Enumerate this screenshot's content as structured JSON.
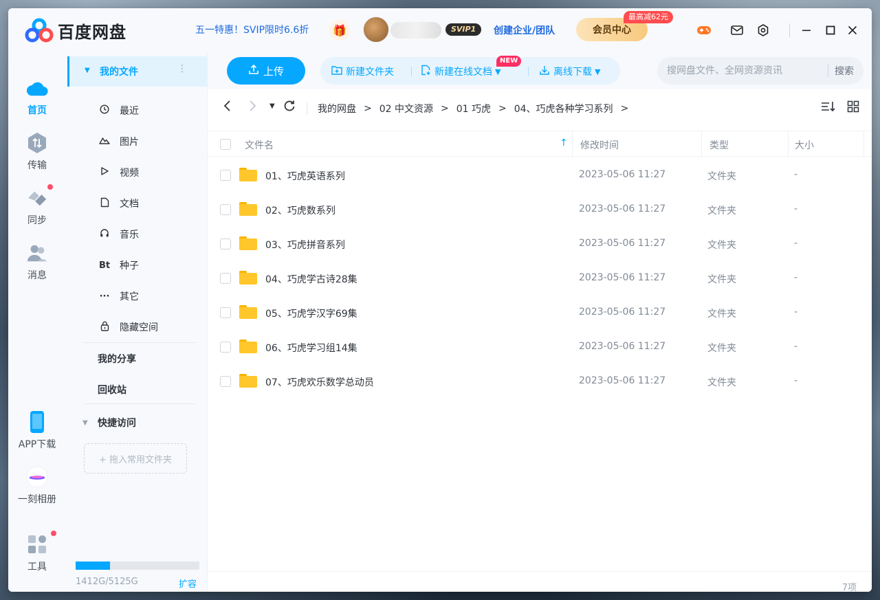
{
  "app": {
    "name": "百度网盘"
  },
  "header": {
    "promo": "五一特惠！SVIP限时6.6折",
    "svip_label": "SVIP1",
    "enterprise": "创建企业/团队",
    "vip_center": "会员中心",
    "vip_badge": "最高减62元"
  },
  "rail": {
    "home": "首页",
    "transfer": "传输",
    "sync": "同步",
    "message": "消息",
    "app_download": "APP下载",
    "album": "一刻相册",
    "tools": "工具"
  },
  "sidebar": {
    "my_files": "我的文件",
    "items": [
      {
        "label": "最近",
        "icon": "clock-icon"
      },
      {
        "label": "图片",
        "icon": "image-icon"
      },
      {
        "label": "视频",
        "icon": "video-icon"
      },
      {
        "label": "文档",
        "icon": "document-icon"
      },
      {
        "label": "音乐",
        "icon": "headphones-icon"
      },
      {
        "label": "种子",
        "icon": "bt-icon"
      },
      {
        "label": "其它",
        "icon": "more-icon"
      },
      {
        "label": "隐藏空间",
        "icon": "lock-icon"
      }
    ],
    "my_share": "我的分享",
    "recycle": "回收站",
    "quick_access": "快捷访问",
    "drop_hint": "+ 拖入常用文件夹",
    "storage_text": "1412G/5125G",
    "storage_used_fraction": 0.2755,
    "expand": "扩容"
  },
  "toolbar": {
    "upload": "上传",
    "new_folder": "新建文件夹",
    "new_doc": "新建在线文档",
    "new_badge": "NEW",
    "offline": "离线下载",
    "search_placeholder": "搜网盘文件、全网资源资讯",
    "search_btn": "搜索"
  },
  "breadcrumb": [
    "我的网盘",
    "02 中文资源",
    "01 巧虎",
    "04、巧虎各种学习系列"
  ],
  "table": {
    "headers": {
      "name": "文件名",
      "modified": "修改时间",
      "type": "类型",
      "size": "大小"
    },
    "rows": [
      {
        "name": "01、巧虎英语系列",
        "modified": "2023-05-06 11:27",
        "type": "文件夹",
        "size": "-"
      },
      {
        "name": "02、巧虎数系列",
        "modified": "2023-05-06 11:27",
        "type": "文件夹",
        "size": "-"
      },
      {
        "name": "03、巧虎拼音系列",
        "modified": "2023-05-06 11:27",
        "type": "文件夹",
        "size": "-"
      },
      {
        "name": "04、巧虎学古诗28集",
        "modified": "2023-05-06 11:27",
        "type": "文件夹",
        "size": "-"
      },
      {
        "name": "05、巧虎学汉字69集",
        "modified": "2023-05-06 11:27",
        "type": "文件夹",
        "size": "-"
      },
      {
        "name": "06、巧虎学习组14集",
        "modified": "2023-05-06 11:27",
        "type": "文件夹",
        "size": "-"
      },
      {
        "name": "07、巧虎欢乐数学总动员",
        "modified": "2023-05-06 11:27",
        "type": "文件夹",
        "size": "-"
      }
    ]
  },
  "footer": {
    "count": "7项"
  },
  "colors": {
    "accent": "#06a7ff",
    "folder": "#ffc72c",
    "badge": "#ff4d4f"
  }
}
